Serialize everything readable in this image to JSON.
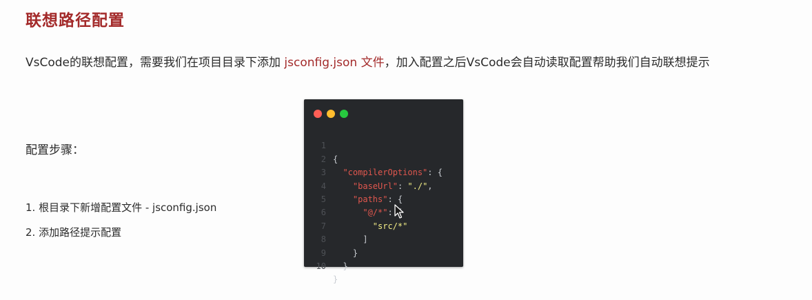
{
  "title": "联想路径配置",
  "intro": {
    "before": "VsCode的联想配置，需要我们在项目目录下添加 ",
    "highlight": "jsconfig.json 文件",
    "after": "，加入配置之后VsCode会自动读取配置帮助我们自动联想提示"
  },
  "steps_title": "配置步骤：",
  "steps": [
    "1. 根目录下新增配置文件 - jsconfig.json",
    "2. 添加路径提示配置"
  ],
  "code_window": {
    "dot_colors": [
      "#ff5f56",
      "#ffbd2e",
      "#27c93f"
    ],
    "line_numbers": [
      "1",
      "2",
      "3",
      "4",
      "5",
      "6",
      "7",
      "8",
      "9",
      "10"
    ],
    "tokens": {
      "l1_open": "{",
      "l2_key": "\"compilerOptions\"",
      "l2_rest": ": {",
      "l3_key": "\"baseUrl\"",
      "l3_colon": ": ",
      "l3_val": "\"./\"",
      "l3_comma": ",",
      "l4_key": "\"paths\"",
      "l4_rest": ": {",
      "l5_key": "\"@/*\"",
      "l5_rest": ": [",
      "l6_val": "\"src/*\"",
      "l7": "]",
      "l8": "}",
      "l9": "}",
      "l10": "}"
    }
  },
  "colors": {
    "title": "#a32a2a",
    "highlight": "#a32a2a",
    "code_bg": "#26282b",
    "code_key": "#e0574e",
    "code_string": "#f1ec86"
  },
  "icons": {
    "cursor": "mouse-pointer-icon"
  }
}
